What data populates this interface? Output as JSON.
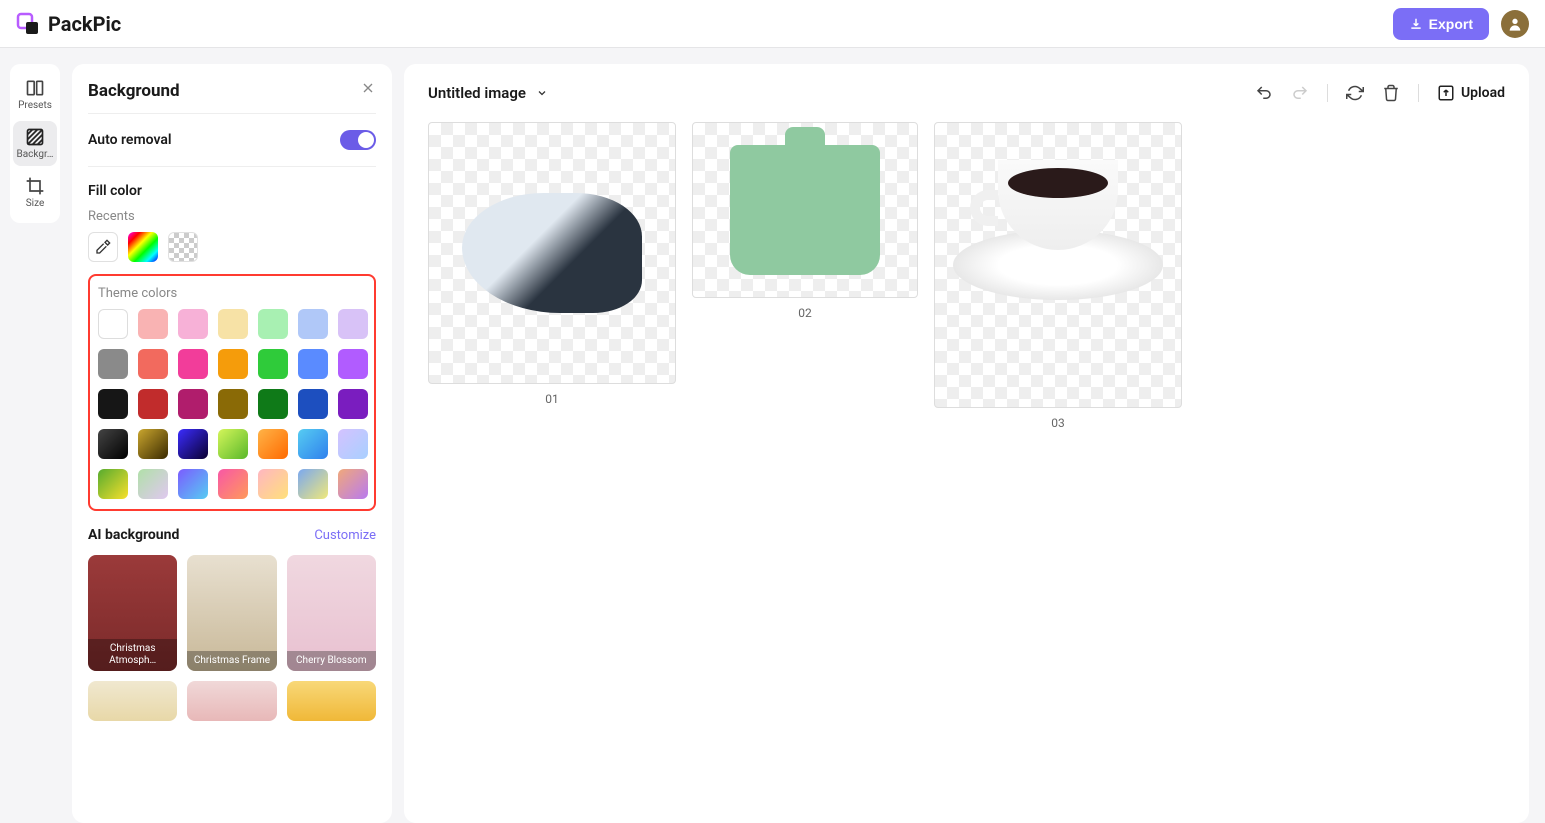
{
  "header": {
    "app_name": "PackPic",
    "export_label": "Export"
  },
  "tool_rail": {
    "presets": "Presets",
    "background": "Backgr…",
    "size": "Size"
  },
  "panel": {
    "title": "Background",
    "auto_removal": "Auto removal",
    "fill_color": "Fill color",
    "recents": "Recents",
    "theme_colors": "Theme colors",
    "ai_background": "AI background",
    "customize": "Customize",
    "ai_items": [
      {
        "label": "Christmas Atmosph…"
      },
      {
        "label": "Christmas Frame"
      },
      {
        "label": "Cherry Blossom"
      }
    ],
    "theme_palette": {
      "row1": [
        "#ffffff",
        "#f9b3b3",
        "#f7b1d7",
        "#f7e2a6",
        "#a8f0b2",
        "#b0c8f8",
        "#d8c2f7"
      ],
      "row2": [
        "#8a8a8a",
        "#f26a5e",
        "#f23d9a",
        "#f59c0b",
        "#2fcb3a",
        "#5a8bff",
        "#b15cff"
      ],
      "row3": [
        "#161616",
        "#c12c2c",
        "#b01d6c",
        "#8a6a06",
        "#0f7a18",
        "#1d4fbf",
        "#7a1dbf"
      ],
      "grad1": [
        "linear-gradient(135deg,#444,#000)",
        "linear-gradient(135deg,#caa62e,#3a2a00)",
        "linear-gradient(135deg,#3b2cff,#0a0030)",
        "linear-gradient(135deg,#d4f55a,#5ab82a)",
        "linear-gradient(135deg,#ffb347,#ff6a00)",
        "linear-gradient(135deg,#56ccf2,#2f80ed)",
        "linear-gradient(135deg,#d4c2ff,#a8d0ff)"
      ],
      "grad2": [
        "linear-gradient(135deg,#56ab2f,#f8e02c)",
        "linear-gradient(135deg,#b0e0a8,#e0c8f0)",
        "linear-gradient(135deg,#7b5cff,#56ccf2)",
        "linear-gradient(135deg,#f857a6,#ff9a5a)",
        "linear-gradient(135deg,#ffb6c1,#ffe07a)",
        "linear-gradient(135deg,#7aa8f0,#f0e87a)",
        "linear-gradient(135deg,#f0a87a,#b87af0)"
      ]
    }
  },
  "canvas": {
    "title": "Untitled image",
    "upload": "Upload",
    "images": [
      {
        "label": "01"
      },
      {
        "label": "02"
      },
      {
        "label": "03"
      }
    ]
  }
}
